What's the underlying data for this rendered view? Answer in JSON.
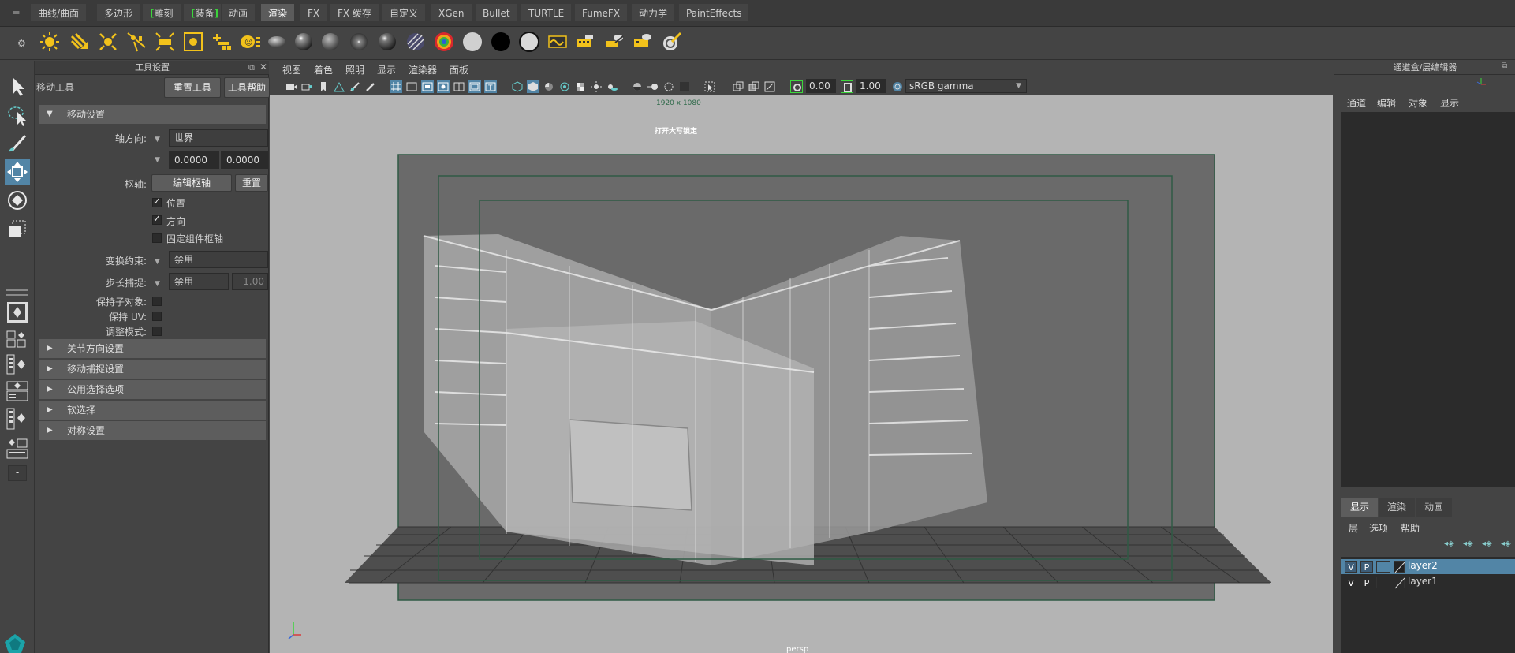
{
  "shelf": {
    "tabs": [
      "曲线/曲面",
      "多边形",
      "雕刻",
      "装备",
      "动画",
      "渲染",
      "FX",
      "FX 缓存",
      "自定义",
      "XGen",
      "Bullet",
      "TURTLE",
      "FumeFX",
      "动力学",
      "PaintEffects"
    ],
    "active_tab": "渲染",
    "icons": [
      "light-icon",
      "spotlight-icon",
      "point-light-icon",
      "area-light-icon",
      "directional-light-icon",
      "volume-light-icon",
      "camera-icon",
      "camera-aim-icon",
      "sphere-lambert-icon",
      "sphere-blinn-icon",
      "sphere-phong-icon",
      "sphere-anisotropic-icon",
      "sphere-ramp-icon",
      "sphere-stripe-icon",
      "color-wheel-icon",
      "sphere-white-icon",
      "sphere-black-icon",
      "sphere-gray-icon",
      "render-view-icon",
      "render-settings-icon",
      "ipr-render-icon",
      "batch-render-icon",
      "hypershade-icon"
    ]
  },
  "tool_settings": {
    "title": "工具设置",
    "tool_name": "移动工具",
    "reset_button": "重置工具",
    "help_button": "工具帮助",
    "section_move": "移动设置",
    "axis_label": "轴方向:",
    "axis_value": "世界",
    "axis_x": "0.0000",
    "axis_y": "0.0000",
    "pivot_label": "枢轴:",
    "edit_pivot": "编辑枢轴",
    "reset_pivot": "重置",
    "position": "位置",
    "orientation": "方向",
    "pin_pivot": "固定组件枢轴",
    "constraint_label": "变换约束:",
    "constraint_value": "禁用",
    "step_label": "步长捕捉:",
    "step_value": "禁用",
    "step_amount": "1.00",
    "keep_child": "保持子对象:",
    "keep_uv": "保持 UV:",
    "tweak_mode": "调整模式:",
    "sections": [
      "关节方向设置",
      "移动捕捉设置",
      "公用选择选项",
      "软选择",
      "对称设置"
    ]
  },
  "viewport": {
    "menus": [
      "视图",
      "着色",
      "照明",
      "显示",
      "渲染器",
      "面板"
    ],
    "exposure": "0.00",
    "gamma": "1.00",
    "color_space": "sRGB gamma",
    "resolution": "1920 x 1080",
    "lock_label": "打开大写锁定",
    "camera": "persp",
    "bg_color": "#b4b4b4"
  },
  "channel_box": {
    "title": "通道盒/层编辑器",
    "menus": [
      "通道",
      "编辑",
      "对象",
      "显示"
    ],
    "layer_tabs": [
      "显示",
      "渲染",
      "动画"
    ],
    "layer_menus": [
      "层",
      "选项",
      "帮助"
    ],
    "layers": [
      {
        "v": "V",
        "p": "P",
        "name": "layer2",
        "selected": true
      },
      {
        "v": "V",
        "p": "P",
        "name": "layer1",
        "selected": false
      }
    ]
  },
  "colors": {
    "accent": "#5285a6",
    "panel": "#444444",
    "dark": "#2b2b2b",
    "viewport_bg": "#b4b4b4",
    "gate": "#2f5a44"
  }
}
